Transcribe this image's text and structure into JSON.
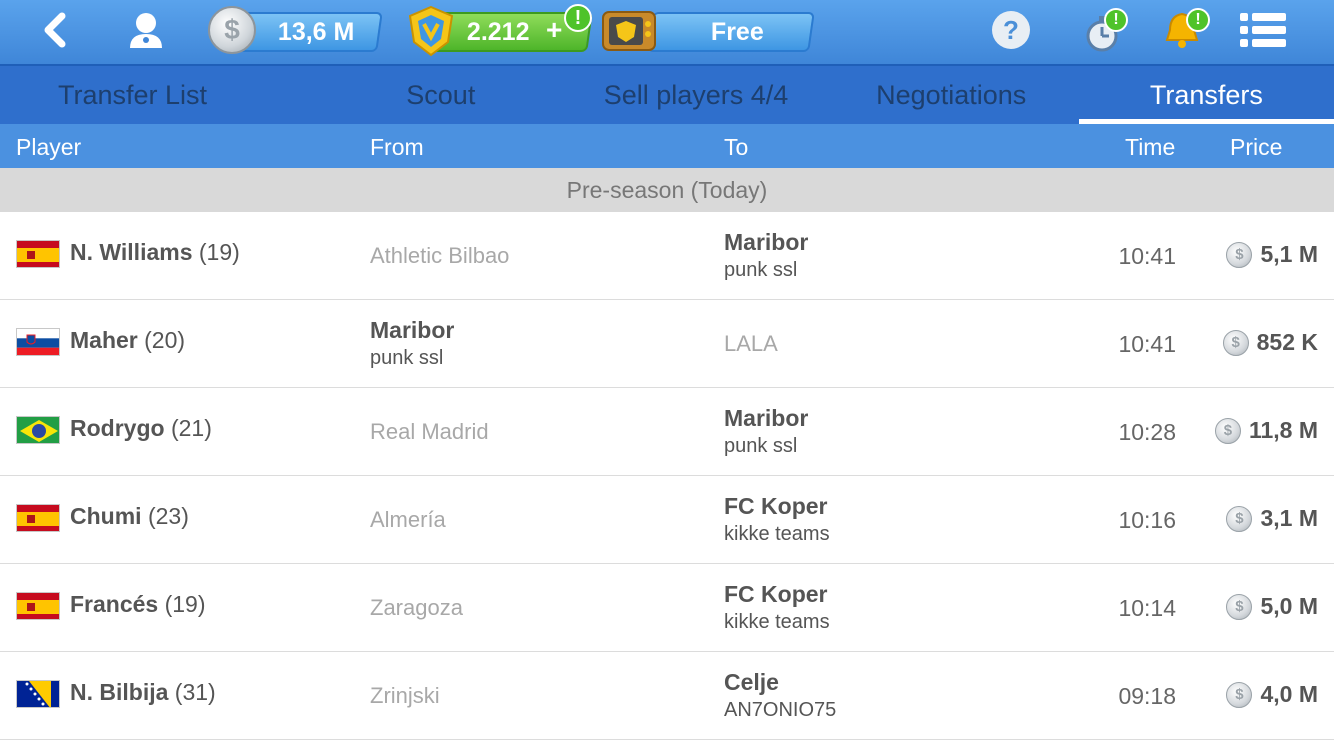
{
  "topbar": {
    "money": "13,6 M",
    "tokens": "2.212",
    "plus": "+",
    "free_label": "Free",
    "alert_mark": "!",
    "help_mark": "?",
    "coin_symbol": "$"
  },
  "tabs": [
    {
      "label": "Transfer List",
      "active": false
    },
    {
      "label": "Scout",
      "active": false
    },
    {
      "label": "Sell players 4/4",
      "active": false
    },
    {
      "label": "Negotiations",
      "active": false
    },
    {
      "label": "Transfers",
      "active": true
    }
  ],
  "columns": {
    "player": "Player",
    "from": "From",
    "to": "To",
    "time": "Time",
    "price": "Price"
  },
  "section_label": "Pre-season (Today)",
  "transfers": [
    {
      "flag": "spain",
      "name": "N. Williams",
      "age": "(19)",
      "from_team": "Athletic Bilbao",
      "from_manager": "",
      "to_team": "Maribor",
      "to_manager": "punk ssl",
      "time": "10:41",
      "price": "5,1 M"
    },
    {
      "flag": "slovenia",
      "name": "Maher",
      "age": "(20)",
      "from_team": "Maribor",
      "from_manager": "punk ssl",
      "to_team": "LALA",
      "to_manager": "",
      "time": "10:41",
      "price": "852 K"
    },
    {
      "flag": "brazil",
      "name": "Rodrygo",
      "age": "(21)",
      "from_team": "Real Madrid",
      "from_manager": "",
      "to_team": "Maribor",
      "to_manager": "punk ssl",
      "time": "10:28",
      "price": "11,8 M"
    },
    {
      "flag": "spain",
      "name": "Chumi",
      "age": "(23)",
      "from_team": "Almería",
      "from_manager": "",
      "to_team": "FC Koper",
      "to_manager": "kikke teams",
      "time": "10:16",
      "price": "3,1 M"
    },
    {
      "flag": "spain",
      "name": "Francés",
      "age": "(19)",
      "from_team": "Zaragoza",
      "from_manager": "",
      "to_team": "FC Koper",
      "to_manager": "kikke teams",
      "time": "10:14",
      "price": "5,0 M"
    },
    {
      "flag": "bosnia",
      "name": "N. Bilbija",
      "age": "(31)",
      "from_team": "Zrinjski",
      "from_manager": "",
      "to_team": "Celje",
      "to_manager": "AN7ONIO75",
      "time": "09:18",
      "price": "4,0 M"
    }
  ]
}
